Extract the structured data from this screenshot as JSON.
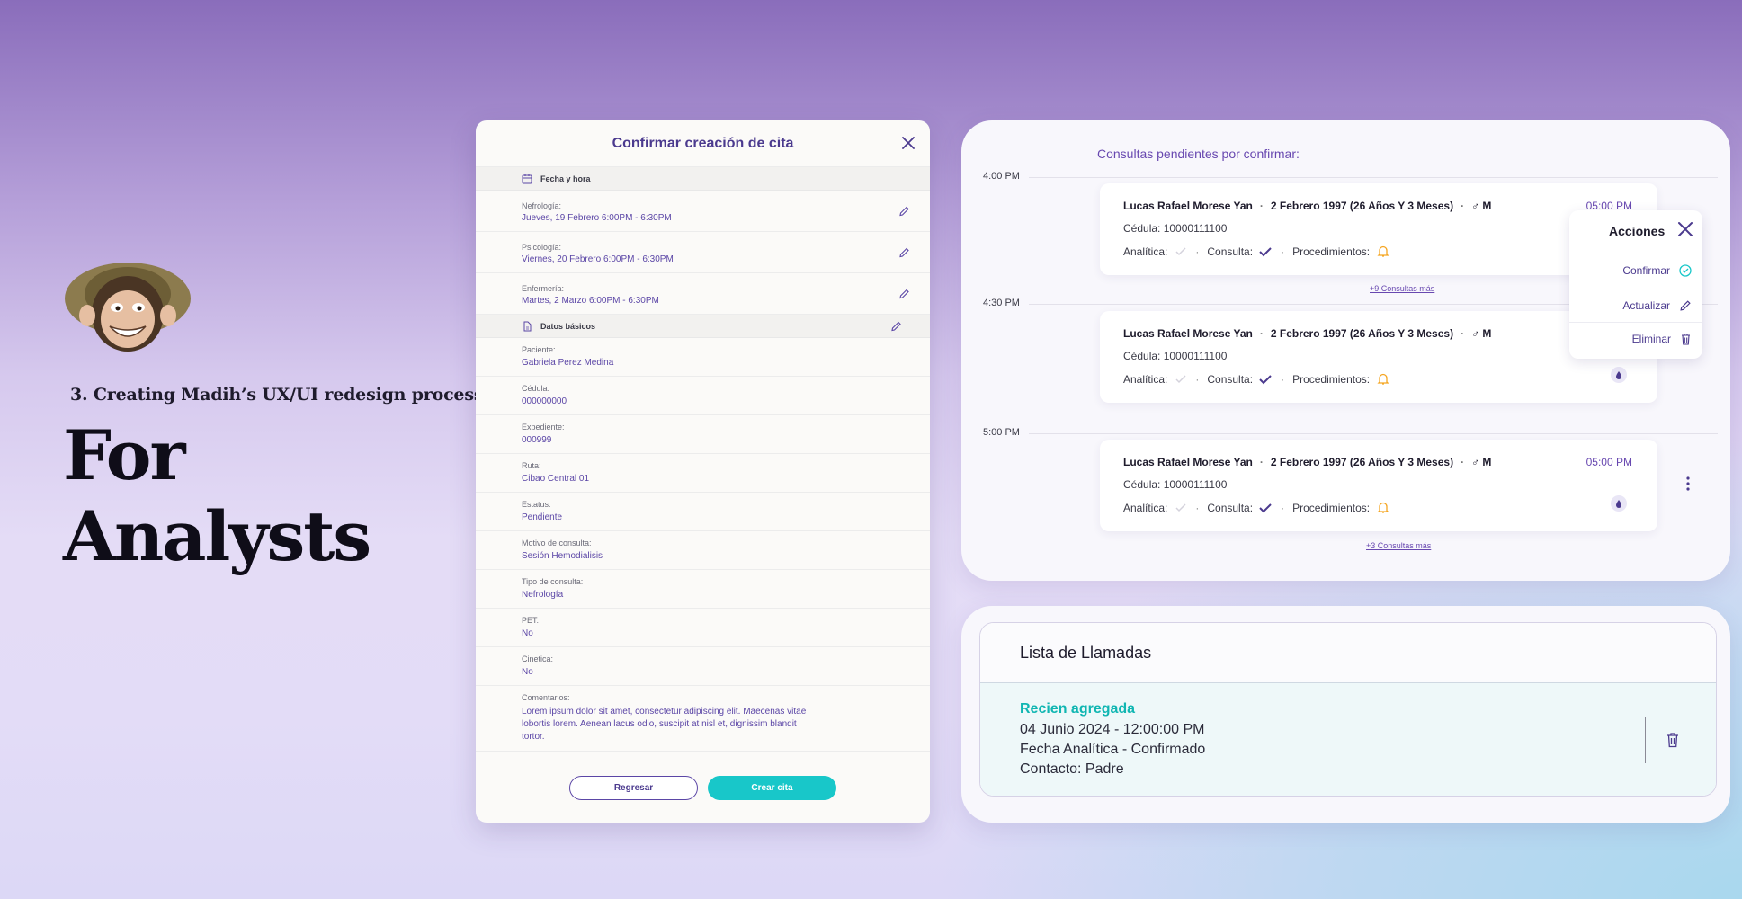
{
  "intro": {
    "subtitle": "3.  Creating Madih’s UX/UI redesign process",
    "title_line1": "For",
    "title_line2": "Analysts"
  },
  "modal": {
    "title": "Confirmar creación de cita",
    "section_schedule": "Fecha y hora",
    "appointments": [
      {
        "label": "Nefrología:",
        "value": "Jueves, 19 Febrero   6:00PM - 6:30PM"
      },
      {
        "label": "Psicología:",
        "value": "Viernes, 20 Febrero   6:00PM - 6:30PM"
      },
      {
        "label": "Enfermería:",
        "value": "Martes, 2 Marzo   6:00PM - 6:30PM"
      }
    ],
    "section_basic": "Datos básicos",
    "fields": [
      {
        "label": "Paciente:",
        "value": "Gabriela Perez Medina"
      },
      {
        "label": "Cédula:",
        "value": "000000000"
      },
      {
        "label": "Expediente:",
        "value": "000999"
      },
      {
        "label": "Ruta:",
        "value": "Cibao Central 01"
      },
      {
        "label": "Estatus:",
        "value": "Pendiente"
      },
      {
        "label": "Motivo de consulta:",
        "value": "Sesión Hemodialisis"
      },
      {
        "label": "Tipo de consulta:",
        "value": "Nefrología"
      },
      {
        "label": "PET:",
        "value": "No"
      },
      {
        "label": "Cinetica:",
        "value": "No"
      }
    ],
    "comments_label": "Comentarios:",
    "comments_value": "Lorem ipsum dolor sit amet, consectetur adipiscing elit. Maecenas vitae  lobortis lorem. Aenean lacus odio, suscipit at nisl et, dignissim blandit tortor.",
    "back_button": "Regresar",
    "create_button": "Crear cita"
  },
  "schedule": {
    "title": "Consultas pendientes por confirmar:",
    "times": [
      "4:00 PM",
      "4:30 PM",
      "5:00 PM"
    ],
    "cards": [
      {
        "name": "Lucas Rafael Morese Yan",
        "dob": "2 Febrero 1997 (26 Años Y 3 Meses)",
        "sex": "M",
        "time": "05:00 PM",
        "id": "Cédula: 10000111100",
        "analitica": "Analítica:",
        "consulta": "Consulta:",
        "procedimientos": "Procedimientos:"
      },
      {
        "name": "Lucas Rafael Morese Yan",
        "dob": "2 Febrero 1997 (26 Años Y 3 Meses)",
        "sex": "M",
        "time": "",
        "id": "Cédula: 10000111100",
        "analitica": "Analítica:",
        "consulta": "Consulta:",
        "procedimientos": "Procedimientos:"
      },
      {
        "name": "Lucas Rafael Morese Yan",
        "dob": "2 Febrero 1997 (26 Años Y 3 Meses)",
        "sex": "M",
        "time": "05:00 PM",
        "id": "Cédula: 10000111100",
        "analitica": "Analítica:",
        "consulta": "Consulta:",
        "procedimientos": "Procedimientos:"
      }
    ],
    "more_1": "+9 Consultas más",
    "more_2": "+3 Consultas más",
    "actions": {
      "title": "Acciones",
      "confirm": "Confirmar",
      "update": "Actualizar",
      "delete": "Eliminar"
    }
  },
  "calls": {
    "title": "Lista de Llamadas",
    "status": "Recien agregada",
    "datetime": "04 Junio 2024 - 12:00:00 PM",
    "detail": "Fecha Analítica - Confirmado",
    "contact": "Contacto: Padre"
  },
  "colors": {
    "accent_purple": "#5b46a6",
    "teal": "#18c7c9",
    "warning": "#f5a623"
  }
}
